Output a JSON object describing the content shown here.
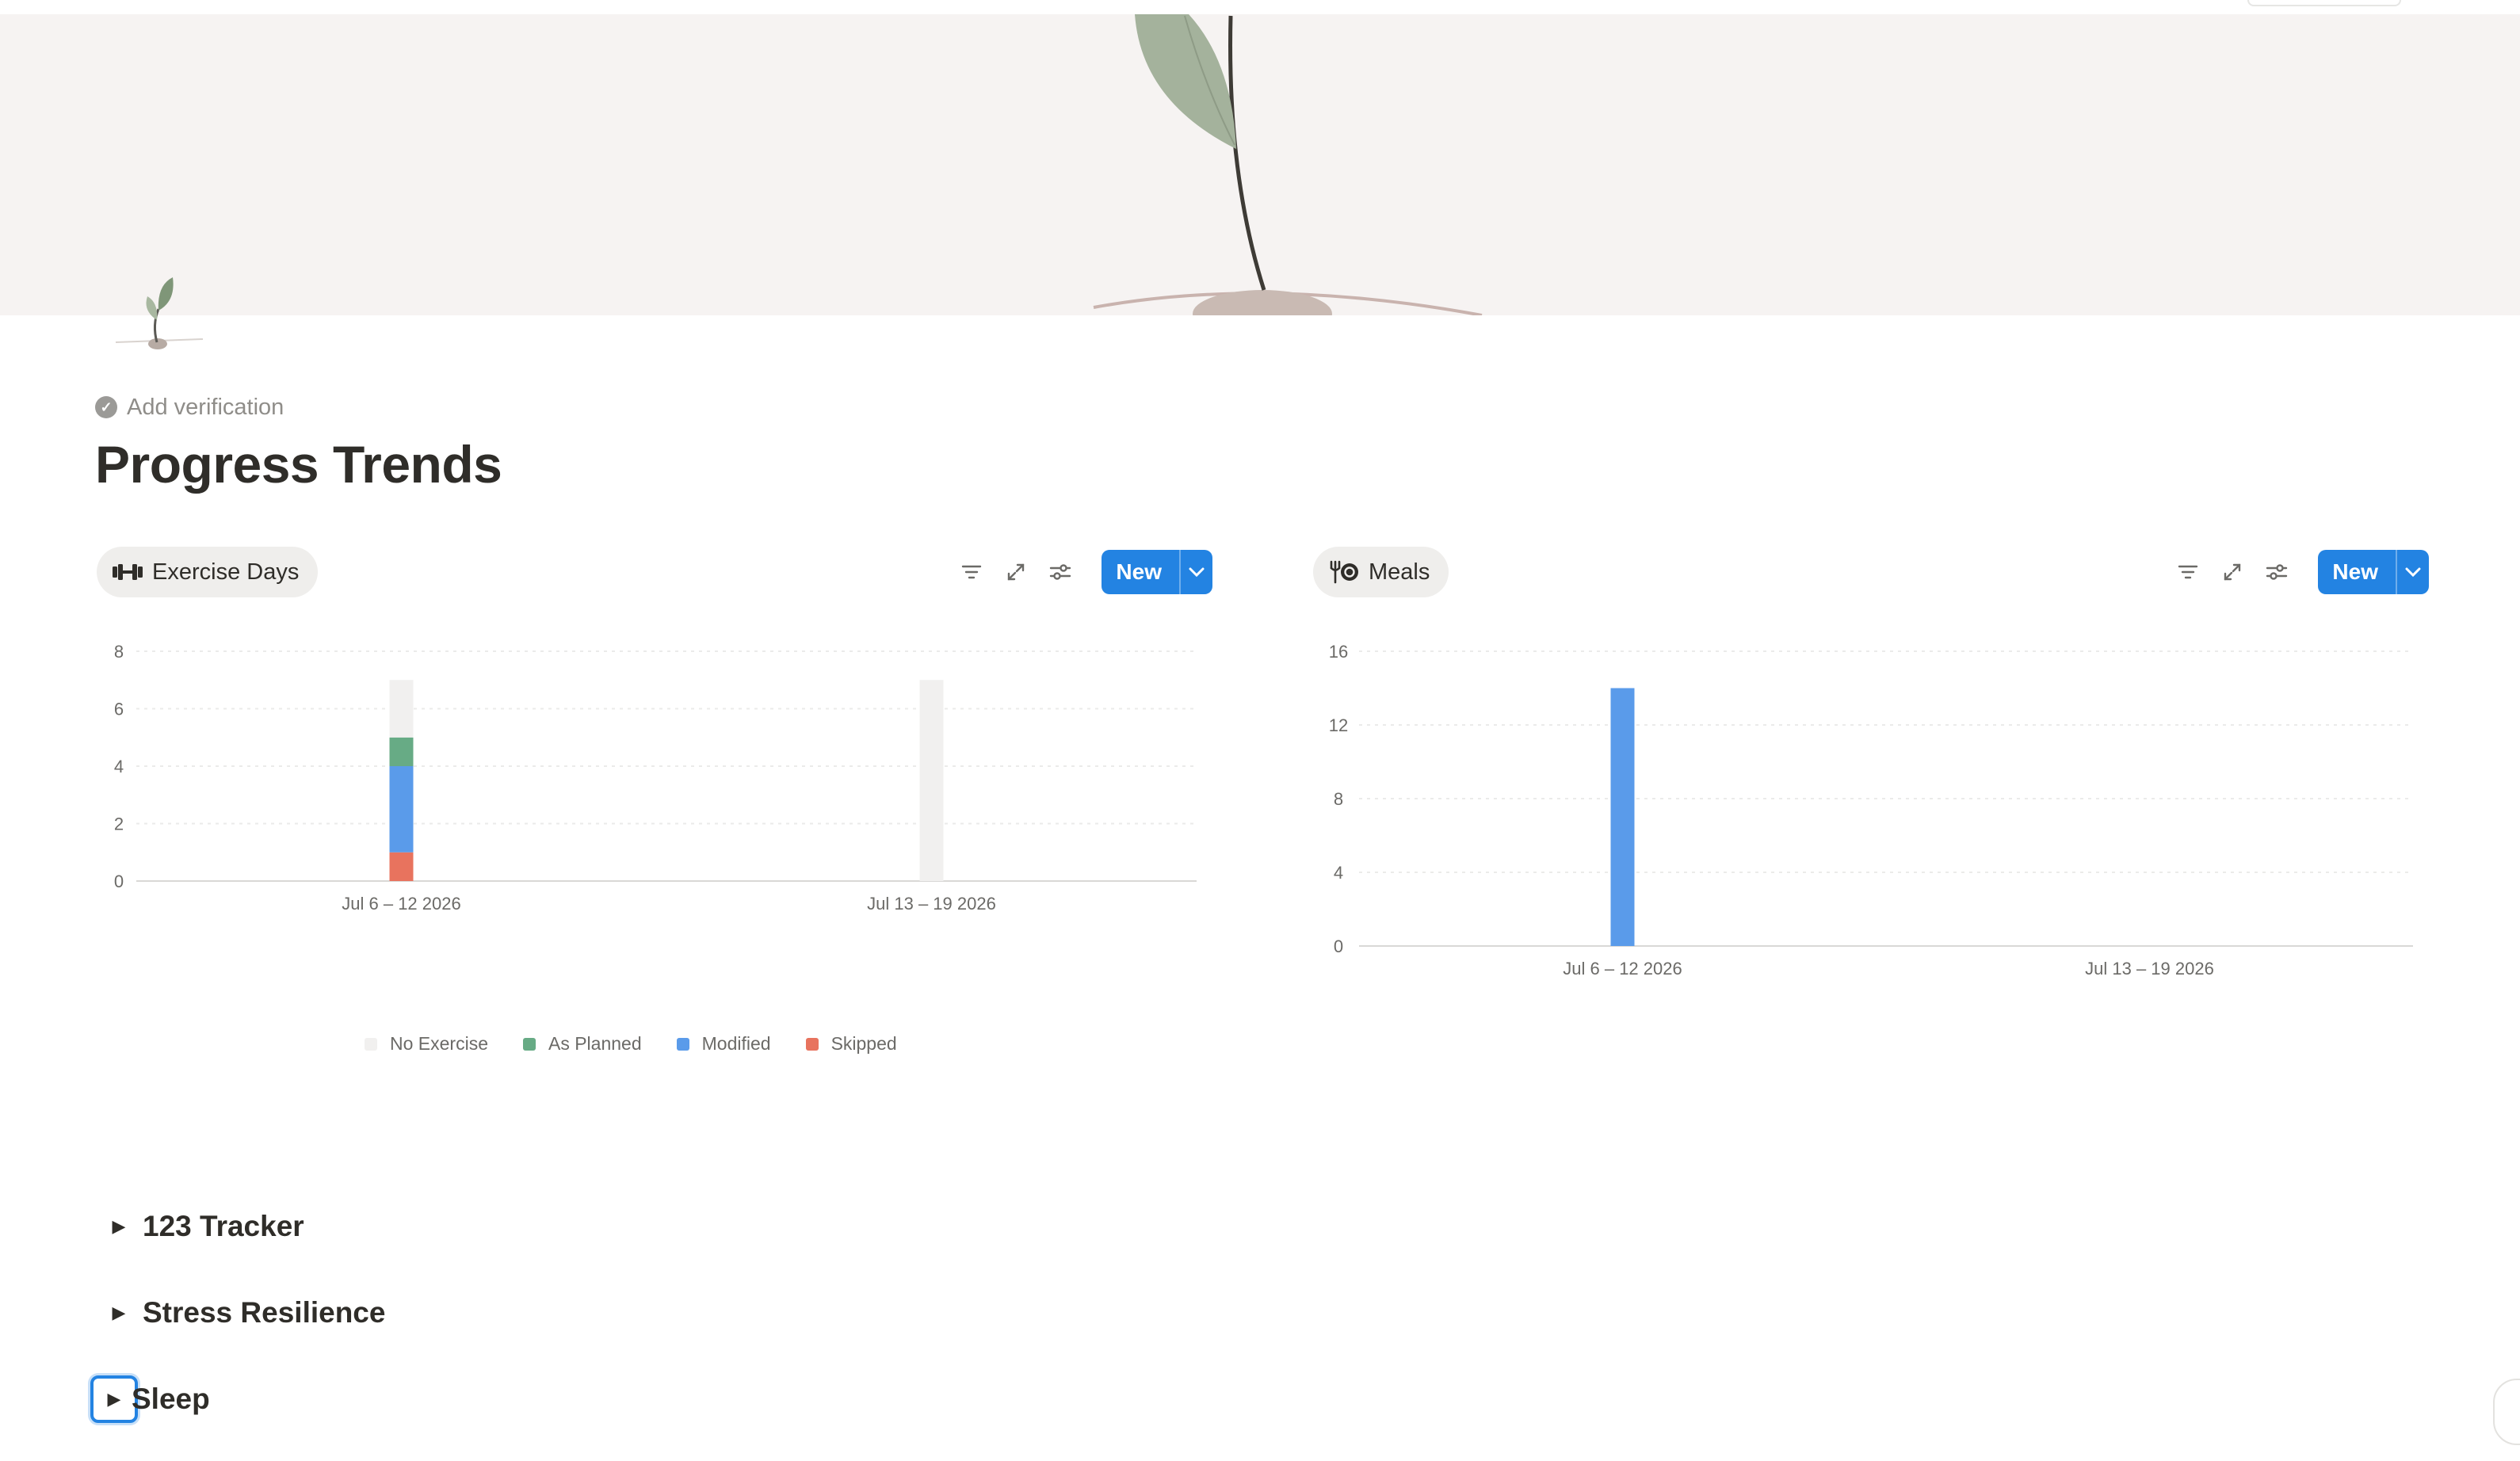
{
  "page": {
    "verification_label": "Add verification",
    "title": "Progress Trends"
  },
  "exercise": {
    "tab_label": "Exercise Days",
    "tab_icon": "dumbbell-icon",
    "new_label": "New"
  },
  "meals": {
    "tab_label": "Meals",
    "tab_icon": "fork-plate-icon",
    "new_label": "New"
  },
  "chart_data": [
    {
      "type": "bar",
      "stacked": true,
      "categories": [
        "Jul 6 – 12 2026",
        "Jul 13 – 19 2026"
      ],
      "series": [
        {
          "name": "Skipped",
          "color": "#e8735e",
          "values": [
            1,
            0
          ]
        },
        {
          "name": "Modified",
          "color": "#5a9bea",
          "values": [
            3,
            0
          ]
        },
        {
          "name": "As Planned",
          "color": "#67ab85",
          "values": [
            1,
            0
          ]
        },
        {
          "name": "No Exercise",
          "color": "#f1f0ef",
          "values": [
            2,
            7
          ]
        }
      ],
      "yticks": [
        0,
        2,
        4,
        6,
        8
      ],
      "ylim": [
        0,
        8
      ],
      "legend": [
        "No Exercise",
        "As Planned",
        "Modified",
        "Skipped"
      ],
      "legend_position": "bottom",
      "grid": true
    },
    {
      "type": "bar",
      "categories": [
        "Jul 6 – 12 2026",
        "Jul 13 – 19 2026"
      ],
      "series": [
        {
          "color": "#5a9bea",
          "values": [
            14,
            0
          ]
        }
      ],
      "yticks": [
        0,
        4,
        8,
        12,
        16
      ],
      "ylim": [
        0,
        16
      ],
      "grid": true
    }
  ],
  "toggles": [
    {
      "label": "123 Tracker"
    },
    {
      "label": "Stress Resilience"
    },
    {
      "label": "Sleep"
    }
  ]
}
